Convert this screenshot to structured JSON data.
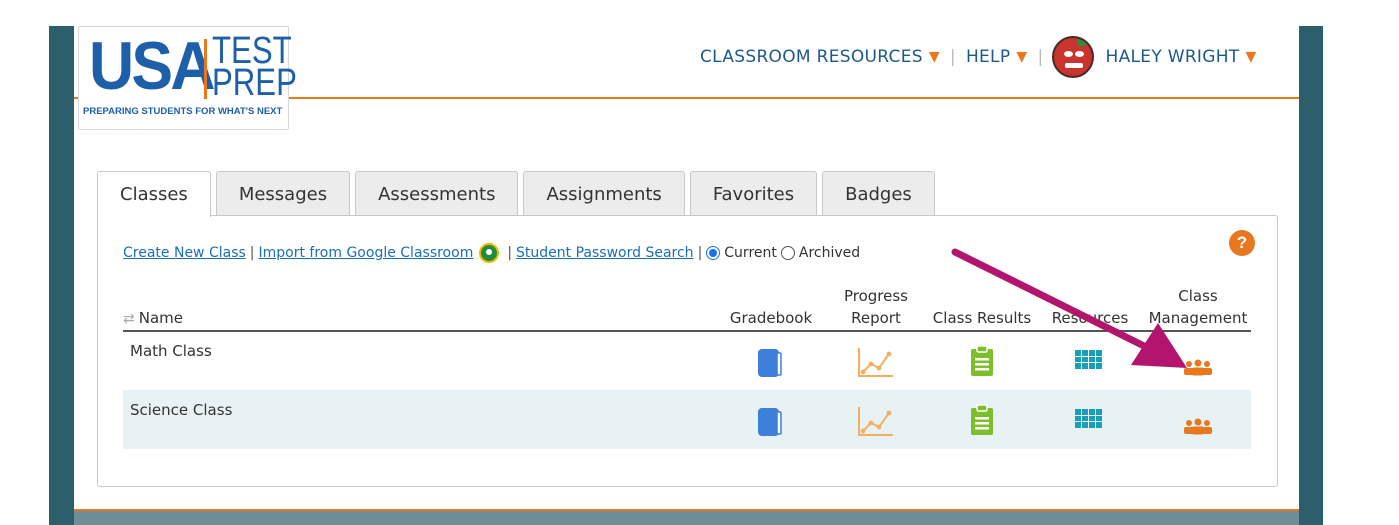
{
  "logo": {
    "word": "USA",
    "test": "TEST",
    "prep": "PREP",
    "tagline": "PREPARING STUDENTS FOR WHAT'S NEXT"
  },
  "nav": {
    "resources": "CLASSROOM RESOURCES",
    "help": "HELP",
    "user": "HALEY WRIGHT",
    "separator": "|"
  },
  "tabs": [
    {
      "label": "Classes",
      "active": true
    },
    {
      "label": "Messages"
    },
    {
      "label": "Assessments"
    },
    {
      "label": "Assignments"
    },
    {
      "label": "Favorites"
    },
    {
      "label": "Badges"
    }
  ],
  "actions": {
    "create": "Create New Class",
    "import": "Import from Google Classroom",
    "password": "Student Password Search",
    "current": "Current",
    "archived": "Archived",
    "pipe": "|"
  },
  "help_icon": "?",
  "table": {
    "headers": {
      "name": "Name",
      "gradebook": "Gradebook",
      "progress_1": "Progress",
      "progress_2": "Report",
      "results": "Class Results",
      "resources": "Resources",
      "mgmt_1": "Class",
      "mgmt_2": "Management"
    },
    "rows": [
      {
        "name": "Math Class"
      },
      {
        "name": "Science Class"
      }
    ]
  },
  "colors": {
    "accent": "#e8771e",
    "brand_blue": "#1d5fa8",
    "sidebar": "#2c5f6b",
    "annotation_arrow": "#b3146e",
    "gradebook_icon": "#3d7fd9",
    "results_icon": "#7cbf2a",
    "resources_icon": "#1a9fb8"
  },
  "icons": {
    "gradebook": "book-icon",
    "progress": "line-chart-icon",
    "results": "clipboard-icon",
    "resources": "grid-icon",
    "management": "people-icon"
  }
}
